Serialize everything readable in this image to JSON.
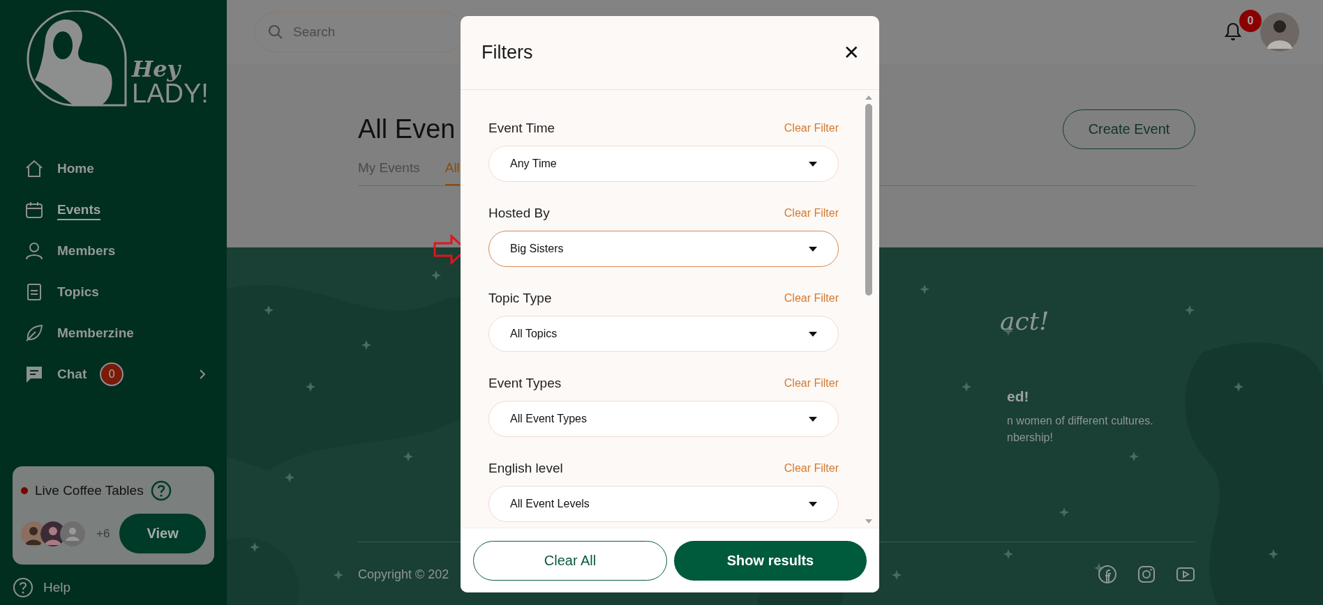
{
  "sidebar": {
    "logo": {
      "line_1": "Hey",
      "line_2": "LADY!"
    },
    "nav_items": [
      {
        "label": "Home",
        "kind": "home",
        "selected": false
      },
      {
        "label": "Events",
        "kind": "calendar",
        "selected": true
      },
      {
        "label": "Members",
        "kind": "person",
        "selected": false
      },
      {
        "label": "Topics",
        "kind": "document",
        "selected": false
      },
      {
        "label": "Memberzine",
        "kind": "leaf",
        "selected": false
      },
      {
        "label": "Chat",
        "kind": "chat",
        "selected": false,
        "badge": "0"
      }
    ],
    "live_card": {
      "title": "Live Coffee Tables",
      "extra_count": "+6",
      "button": "View"
    },
    "help": "Help"
  },
  "topbar": {
    "search": {
      "placeholder": "Search"
    },
    "notification_count": "0"
  },
  "page": {
    "title": "All Even",
    "tabs": [
      {
        "label": "My Events",
        "selected": false
      },
      {
        "label": "All",
        "selected": true
      }
    ],
    "create_button": "Create Event"
  },
  "footer_banner": {
    "script_heading": "act!",
    "heading": "ed!",
    "lines": [
      "n women of different cultures.",
      "nbership!"
    ],
    "copyright": "Copyright © 202"
  },
  "modal": {
    "title": "Filters",
    "close": "✕",
    "filters": [
      {
        "label": "Event Time",
        "clear": "Clear Filter",
        "value": "Any Time",
        "focused": false
      },
      {
        "label": "Hosted By",
        "clear": "Clear Filter",
        "value": "Big Sisters",
        "focused": true
      },
      {
        "label": "Topic Type",
        "clear": "Clear Filter",
        "value": "All Topics",
        "focused": false
      },
      {
        "label": "Event Types",
        "clear": "Clear Filter",
        "value": "All Event Types",
        "focused": false
      },
      {
        "label": "English level",
        "clear": "Clear Filter",
        "value": "All Event Levels",
        "focused": false
      }
    ],
    "clear_all": "Clear All",
    "show_results": "Show results"
  }
}
